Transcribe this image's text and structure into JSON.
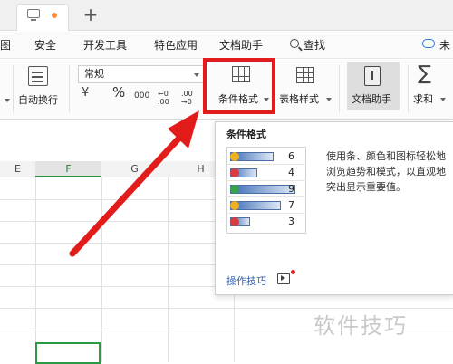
{
  "menu": {
    "items": [
      "图",
      "安全",
      "开发工具",
      "特色应用",
      "文档助手",
      "查找",
      "未"
    ]
  },
  "ribbon": {
    "wrap_label": "自动换行",
    "number_format": "常规",
    "number_symbols": [
      "¥",
      "%",
      "000",
      "←0 .00",
      ".00 →0"
    ],
    "conditional_format_label": "条件格式",
    "table_style_label": "表格样式",
    "doc_assistant_label": "文档助手",
    "sum_label": "求和"
  },
  "sheet": {
    "columns": [
      "E",
      "F",
      "G",
      "H"
    ],
    "selected_column": "F"
  },
  "tooltip": {
    "title": "条件格式",
    "preview_values": [
      "6",
      "4",
      "9",
      "7",
      "3"
    ],
    "description": "使用条、颜色和图标轻松地浏览趋势和模式，以直观地突出显示重要值。",
    "link": "操作技巧"
  },
  "watermark": "软件技巧",
  "colors": {
    "highlight_red": "#e21b1b",
    "selected_green": "#2b9a45",
    "link_blue": "#2f5fae"
  }
}
